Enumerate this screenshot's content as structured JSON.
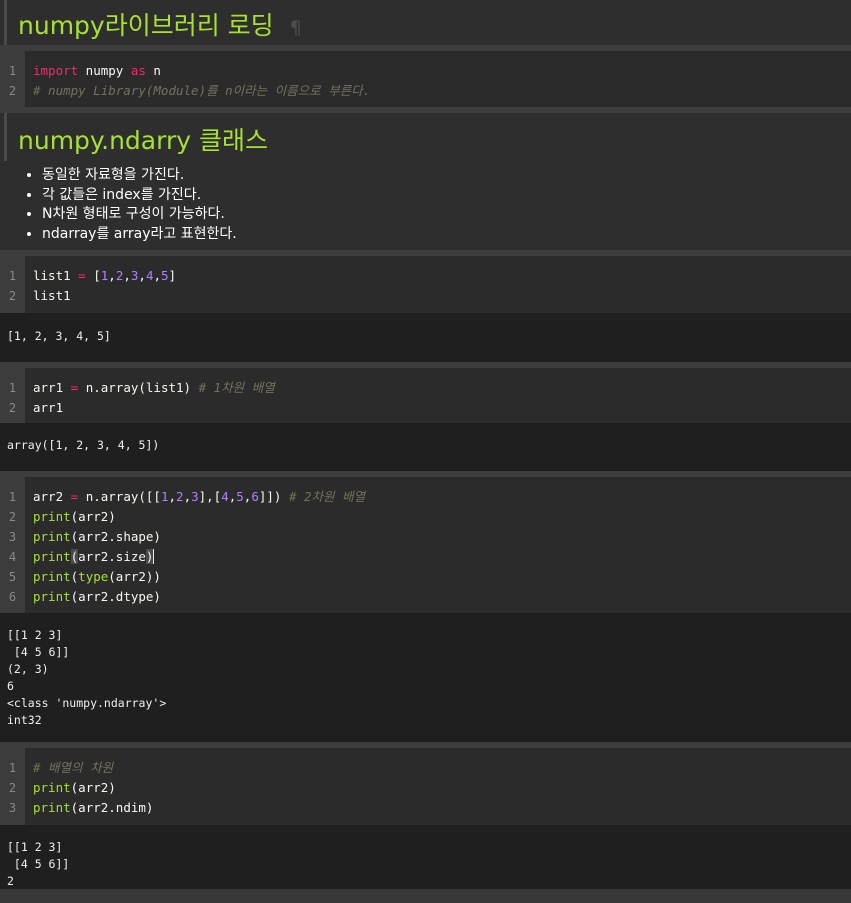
{
  "heading1": {
    "text": "numpy라이브러리 로딩",
    "anchor": "¶"
  },
  "heading2": {
    "text": "numpy.ndarry 클래스"
  },
  "cell1": {
    "gutter": [
      "1",
      "2"
    ],
    "line1": {
      "kw": "import",
      "mod": " numpy ",
      "as": "as",
      "alias": " n"
    },
    "line2": "# numpy Library(Module)를 n이라는 이름으로 부른다."
  },
  "bullets": [
    "동일한 자료형을 가진다.",
    "각 값들은 index를 가진다.",
    "N차원 형태로 구성이 가능하다.",
    "ndarray를 array라고 표현한다."
  ],
  "cell2": {
    "gutter": [
      "1",
      "2"
    ],
    "line1": {
      "name": "list1 ",
      "op": "=",
      "open": " [",
      "n1": "1",
      "c1": ",",
      "n2": "2",
      "c2": ",",
      "n3": "3",
      "c3": ",",
      "n4": "4",
      "c4": ",",
      "n5": "5",
      "close": "]"
    },
    "line2": "list1",
    "output": [
      "[1, 2, 3, 4, 5]"
    ]
  },
  "cell3": {
    "gutter": [
      "1",
      "2"
    ],
    "line1": {
      "name": "arr1 ",
      "op": "=",
      "call": " n.array(list1) ",
      "comment": "# 1차원 배열"
    },
    "line2": "arr1",
    "output": [
      "array([1, 2, 3, 4, 5])"
    ]
  },
  "cell4": {
    "gutter": [
      "1",
      "2",
      "3",
      "4",
      "5",
      "6"
    ],
    "line1": {
      "name": "arr2 ",
      "op": "=",
      "call": " n.array([[",
      "n1": "1",
      "c1": ",",
      "n2": "2",
      "c2": ",",
      "n3": "3",
      "mid": "],[",
      "n4": "4",
      "c4": ",",
      "n5": "5",
      "c5": ",",
      "n6": "6",
      "close": "]]) ",
      "comment": "# 2차원 배열"
    },
    "line2": {
      "fn": "print",
      "rest": "(arr2)"
    },
    "line3": {
      "fn": "print",
      "rest": "(arr2.shape)"
    },
    "line4": {
      "fn": "print",
      "paren": "(",
      "rest": "arr2.size",
      "close": ")"
    },
    "line5": {
      "fn": "print",
      "open": "(",
      "fn2": "type",
      "rest": "(arr2))"
    },
    "line6": {
      "fn": "print",
      "rest": "(arr2.dtype)"
    },
    "output": [
      "[[1 2 3]",
      " [4 5 6]]",
      "(2, 3)",
      "6",
      "<class 'numpy.ndarray'>",
      "int32"
    ]
  },
  "cell5": {
    "gutter": [
      "1",
      "2",
      "3"
    ],
    "line1": "# 배열의 차원",
    "line2": {
      "fn": "print",
      "rest": "(arr2)"
    },
    "line3": {
      "fn": "print",
      "rest": "(arr2.ndim)"
    },
    "output": [
      "[[1 2 3]",
      " [4 5 6]]",
      "2"
    ]
  }
}
